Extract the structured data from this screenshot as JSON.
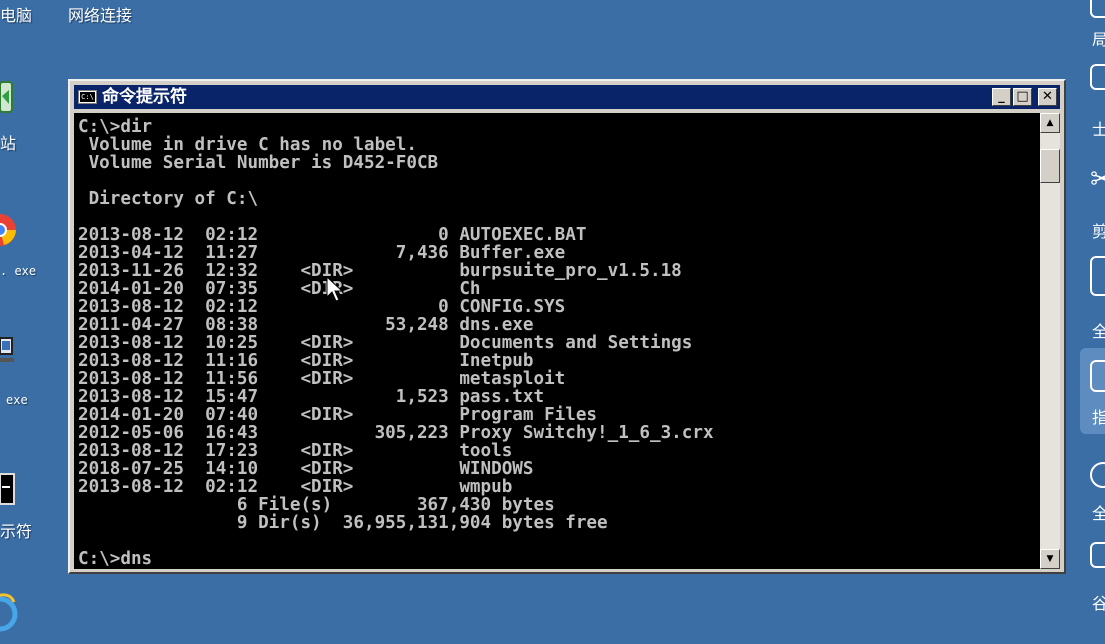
{
  "desktop": {
    "top_labels": [
      "电脑",
      "网络连接"
    ],
    "left_labels": [
      "站",
      ". exe",
      "exe",
      "示符"
    ],
    "right_labels": [
      "局",
      "士",
      "剪",
      "全",
      "指",
      "全",
      "谷"
    ]
  },
  "window": {
    "title": "命令提示符",
    "icon_text": "C:\\",
    "buttons": {
      "minimize": "_",
      "maximize": "□",
      "close": "✕"
    },
    "console_lines": [
      "C:\\>dir",
      " Volume in drive C has no label.",
      " Volume Serial Number is D452-F0CB",
      "",
      " Directory of C:\\",
      "",
      "2013-08-12  02:12                 0 AUTOEXEC.BAT",
      "2013-04-12  11:27             7,436 Buffer.exe",
      "2013-11-26  12:32    <DIR>          burpsuite_pro_v1.5.18",
      "2014-01-20  07:35    <DIR>          Ch",
      "2013-08-12  02:12                 0 CONFIG.SYS",
      "2011-04-27  08:38            53,248 dns.exe",
      "2013-08-12  10:25    <DIR>          Documents and Settings",
      "2013-08-12  11:16    <DIR>          Inetpub",
      "2013-08-12  11:56    <DIR>          metasploit",
      "2013-08-12  15:47             1,523 pass.txt",
      "2014-01-20  07:40    <DIR>          Program Files",
      "2012-05-06  16:43           305,223 Proxy Switchy!_1_6_3.crx",
      "2013-08-12  17:23    <DIR>          tools",
      "2018-07-25  14:10    <DIR>          WINDOWS",
      "2013-08-12  02:12    <DIR>          wmpub",
      "               6 File(s)        367,430 bytes",
      "               9 Dir(s)  36,955,131,904 bytes free",
      "",
      "C:\\>dns"
    ],
    "scrollbar": {
      "up_arrow": "▲",
      "down_arrow": "▼"
    }
  },
  "colors": {
    "desktop": "#3a6ea5",
    "titlebar": "#0a246a",
    "console_bg": "#000000",
    "console_text": "#c0c0c0"
  }
}
